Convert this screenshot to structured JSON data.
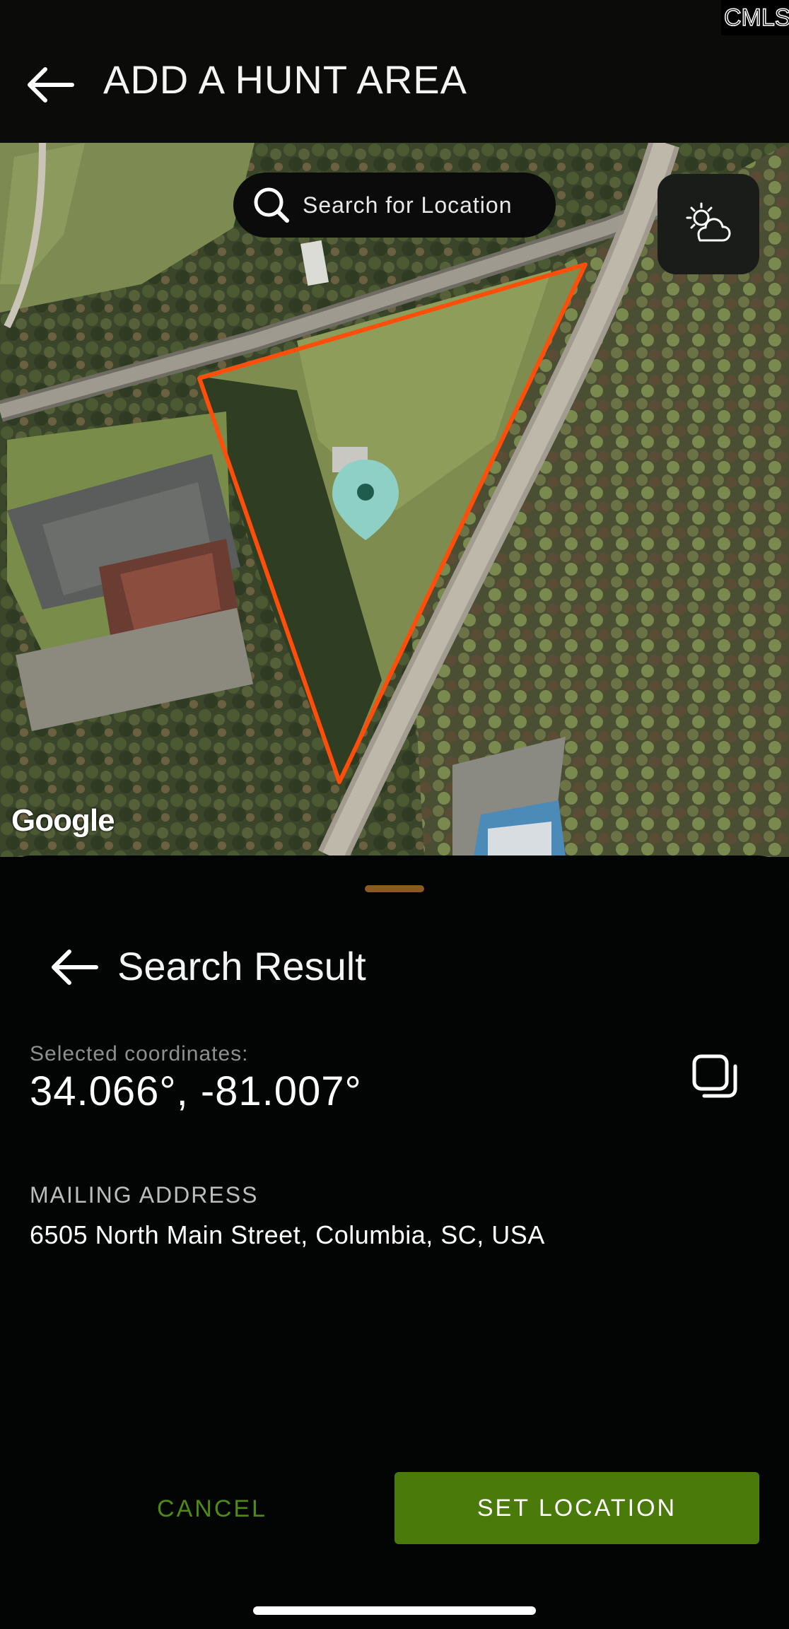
{
  "header": {
    "title": "ADD A HUNT AREA",
    "back_icon": "arrow-left-icon"
  },
  "watermark": {
    "text": "CMLS"
  },
  "map": {
    "search_placeholder": "Search for Location",
    "search_icon": "search-icon",
    "weather_icon": "partly-cloudy-icon",
    "attribution": "Google",
    "boundary_color": "#ff4d0a",
    "pin_color": "#8fd0c6"
  },
  "sheet": {
    "title": "Search Result",
    "back_icon": "arrow-left-icon",
    "coordinates_label": "Selected coordinates:",
    "coordinates_value": "34.066°, -81.007°",
    "copy_icon": "copy-icon",
    "mailing_label": "MAILING ADDRESS",
    "mailing_value": "6505 North Main Street, Columbia, SC, USA"
  },
  "actions": {
    "cancel_label": "CANCEL",
    "set_label": "SET LOCATION",
    "cancel_color": "#4f8a13",
    "set_color": "#4a7a0a"
  }
}
